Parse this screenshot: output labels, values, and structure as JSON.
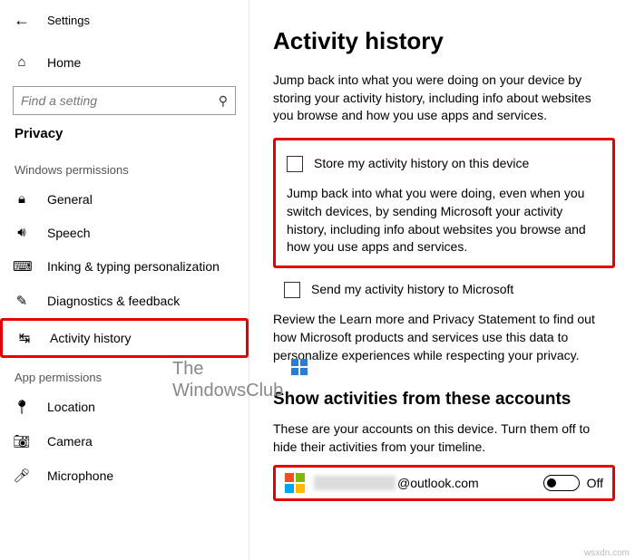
{
  "header": {
    "title": "Settings"
  },
  "search": {
    "placeholder": "Find a setting"
  },
  "sidebar": {
    "home": "Home",
    "category": "Privacy",
    "group1": "Windows permissions",
    "items1": [
      {
        "label": "General"
      },
      {
        "label": "Speech"
      },
      {
        "label": "Inking & typing personalization"
      },
      {
        "label": "Diagnostics & feedback"
      },
      {
        "label": "Activity history"
      }
    ],
    "group2": "App permissions",
    "items2": [
      {
        "label": "Location"
      },
      {
        "label": "Camera"
      },
      {
        "label": "Microphone"
      }
    ]
  },
  "main": {
    "title": "Activity history",
    "intro": "Jump back into what you were doing on your device by storing your activity history, including info about websites you browse and how you use apps and services.",
    "chk1": "Store my activity history on this device",
    "desc2": "Jump back into what you were doing, even when you switch devices, by sending Microsoft your activity history, including info about websites you browse and how you use apps and services.",
    "chk2": "Send my activity history to Microsoft",
    "review": "Review the Learn more and Privacy Statement to find out how Microsoft products and services use this data to personalize experiences while respecting your privacy.",
    "accounts_title": "Show activities from these accounts",
    "accounts_desc": "These are your accounts on this device. Turn them off to hide their activities from your timeline.",
    "email_suffix": "@outlook.com",
    "toggle_state": "Off"
  },
  "watermark": {
    "line1": "The",
    "line2": "WindowsClub"
  },
  "footer": "wsxdn.com"
}
